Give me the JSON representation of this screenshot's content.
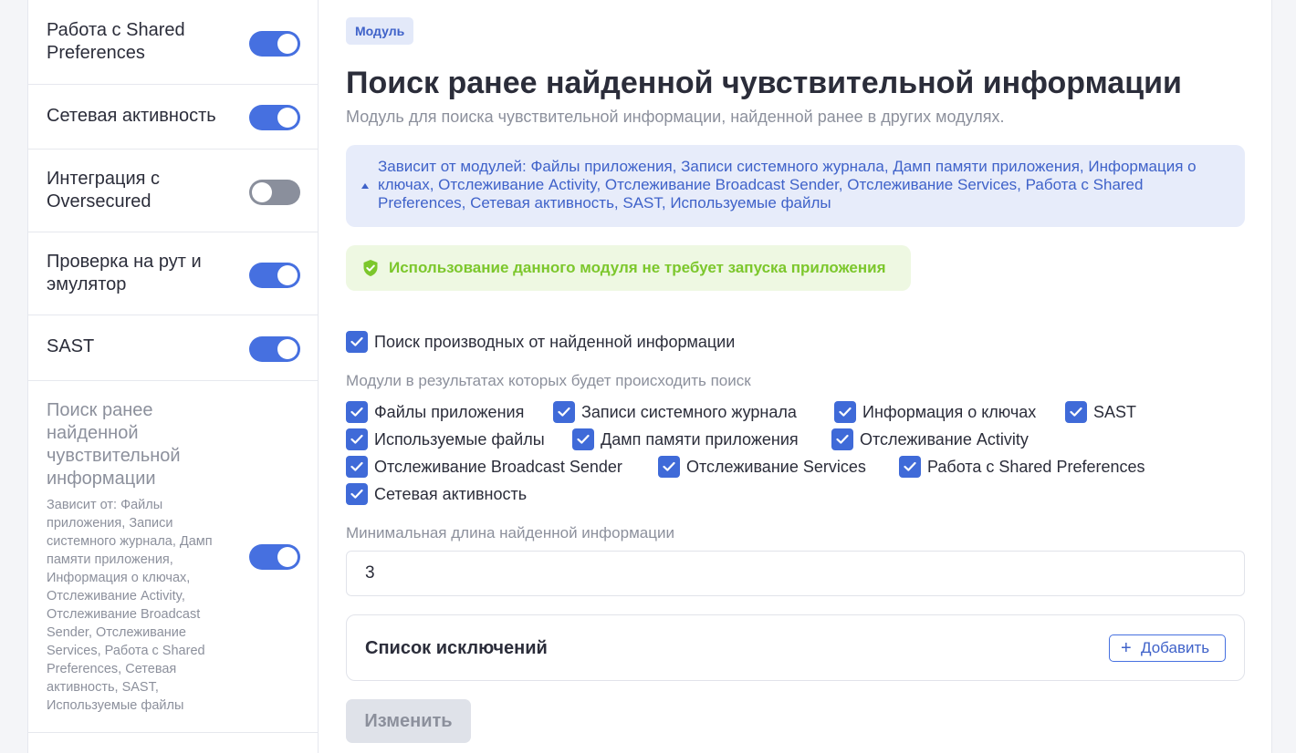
{
  "sidebar": {
    "items": [
      {
        "label": "Работа с Shared Preferences",
        "enabled": true
      },
      {
        "label": "Сетевая активность",
        "enabled": true
      },
      {
        "label": "Интеграция с Oversecured",
        "enabled": false
      },
      {
        "label": "Проверка на рут и эмулятор",
        "enabled": true
      },
      {
        "label": "SAST",
        "enabled": true
      },
      {
        "label": "Поиск ранее найденной чувствительной информации",
        "enabled": true,
        "deps": "Зависит от: Файлы приложения, Записи системного журнала, Дамп памяти приложения, Информация о ключах, Отслеживание Activity, Отслеживание Broadcast Sender, Отслеживание Services, Работа с Shared Preferences, Сетевая активность, SAST, Используемые файлы"
      }
    ]
  },
  "main": {
    "badge": "Модуль",
    "title": "Поиск ранее найденной чувствительной информации",
    "subtitle": "Модуль для поиска чувствительной информации, найденной ранее в других модулях.",
    "depends_text": "Зависит от модулей: Файлы приложения, Записи системного журнала, Дамп памяти приложения, Информация о ключах, Отслеживание Activity, Отслеживание Broadcast Sender, Отслеживание Services, Работа с Shared Preferences, Сетевая активность, SAST, Используемые файлы",
    "no_launch_text": "Использование данного модуля не требует запуска приложения",
    "derived_search_label": "Поиск производных от найденной информации",
    "modules_label": "Модули в результатах которых будет происходить поиск",
    "modules": [
      "Файлы приложения",
      "Записи системного журнала",
      "Информация о ключах",
      "SAST",
      "Используемые файлы",
      "Дамп памяти приложения",
      "Отслеживание Activity",
      "Отслеживание Broadcast Sender",
      "Отслеживание Services",
      "Работа с Shared Preferences",
      "Сетевая активность"
    ],
    "min_length_label": "Минимальная длина найденной информации",
    "min_length_value": "3",
    "exclusions_title": "Список исключений",
    "add_label": "Добавить",
    "submit_label": "Изменить"
  },
  "colors": {
    "accent": "#4670e0",
    "success": "#7cc72c",
    "info_bg": "#e7ecfa"
  }
}
